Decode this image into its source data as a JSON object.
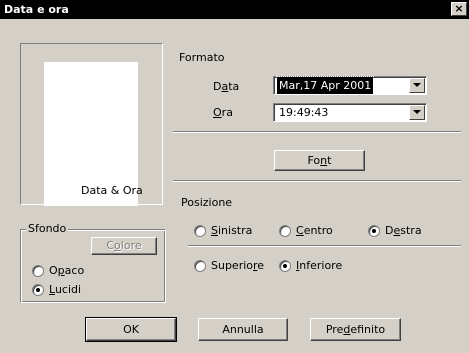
{
  "window": {
    "title": "Data e ora",
    "close_glyph": "×"
  },
  "preview": {
    "label": "Data & Ora"
  },
  "sfondo": {
    "legend": "Sfondo",
    "colore_button": {
      "pre": "C",
      "key": "o",
      "post": "lore",
      "enabled": false
    },
    "options": [
      {
        "pre": "O",
        "key": "p",
        "post": "aco",
        "checked": false
      },
      {
        "pre": "",
        "key": "L",
        "post": "ucidi",
        "checked": true
      }
    ]
  },
  "formato": {
    "label": "Formato",
    "data": {
      "pre": "D",
      "key": "a",
      "post": "ta",
      "value": "Mar,17 Apr 2001"
    },
    "ora": {
      "pre": "",
      "key": "O",
      "post": "ra",
      "value": "19:49:43"
    },
    "font_button": {
      "pre": "Fo",
      "key": "n",
      "post": "t"
    }
  },
  "posizione": {
    "label": "Posizione",
    "horizontal": [
      {
        "pre": "",
        "key": "S",
        "post": "inistra",
        "checked": false
      },
      {
        "pre": "",
        "key": "C",
        "post": "entro",
        "checked": false
      },
      {
        "pre": "D",
        "key": "e",
        "post": "stra",
        "checked": true
      }
    ],
    "vertical": [
      {
        "pre": "Superio",
        "key": "r",
        "post": "e",
        "checked": false
      },
      {
        "pre": "",
        "key": "I",
        "post": "nferiore",
        "checked": true
      }
    ]
  },
  "footer": {
    "ok": "OK",
    "annulla": "Annulla",
    "predefinito": {
      "pre": "Pre",
      "key": "d",
      "post": "efinito"
    }
  },
  "colors": {
    "face": "#d4d0c8",
    "titlebar": "#000000",
    "shadow": "#808080",
    "highlight": "#ffffff"
  }
}
